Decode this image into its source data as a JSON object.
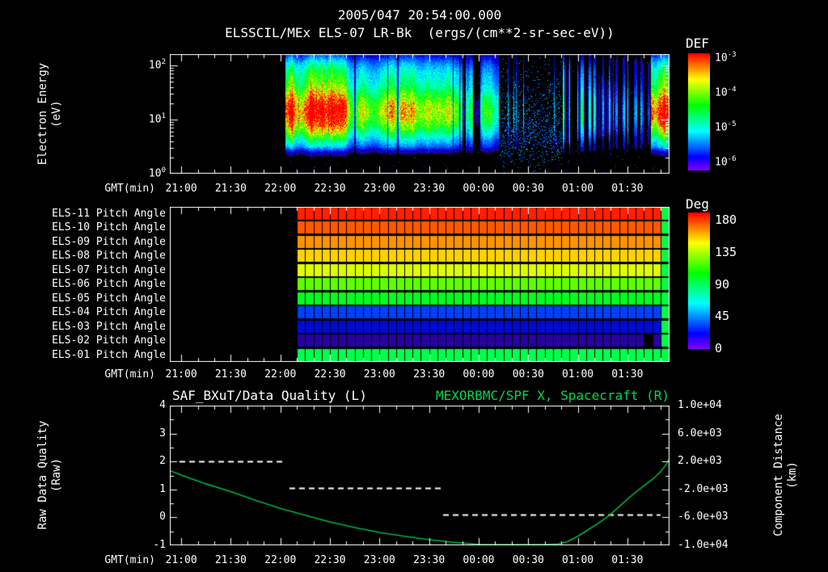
{
  "page": {
    "background": "#000000",
    "foreground": "#ffffff",
    "accent_green": "#00d84e"
  },
  "title": {
    "line1": "2005/047 20:54:00.000",
    "line2": "ELSSCIL/MEx ELS-07 LR-Bk  (ergs/(cm**2-sr-sec-eV))"
  },
  "time_axis": {
    "label": "GMT(min)",
    "ticks": [
      "21:00",
      "21:30",
      "22:00",
      "22:30",
      "23:00",
      "23:30",
      "00:00",
      "00:30",
      "01:00",
      "01:30"
    ],
    "tick_interval_min": 30,
    "t_start_min": -6.9,
    "t_end_min": 295.5
  },
  "labels": {
    "p1_ylabel_line1": "Electron Energy",
    "p1_ylabel_line2": "(eV)",
    "p3_left_ylabel_line1": "Raw Data Quality",
    "p3_left_ylabel_line2": "(Raw)",
    "p3_right_ylabel_line1": "Component Distance",
    "p3_right_ylabel_line2": "(km)"
  },
  "chart_data": [
    {
      "id": "electron_energy_spectrogram",
      "type": "heatmap",
      "title": "ELSSCIL/MEx ELS-07 LR-Bk",
      "units": "ergs/(cm**2-sr-sec-eV)",
      "xlabel": "GMT(min)",
      "ylabel": "Electron Energy (eV)",
      "yscale": "log",
      "ylim_ev": [
        1,
        160
      ],
      "ytick_labels": [
        "10^0",
        "10^1",
        "10^2"
      ],
      "colorbar": {
        "title": "DEF",
        "tick_labels": [
          "10^-3",
          "10^-4",
          "10^-5",
          "10^-6"
        ],
        "zmin": 1e-06,
        "zmax": 0.001
      },
      "band_model": {
        "peak_ev": 14,
        "log10_sigma": 0.4,
        "shoulder_ev": 85,
        "low_cutoff_ev": 3.2
      },
      "segments": [
        {
          "t0": 63,
          "t1": 100,
          "style": "hot",
          "intensity": 0.95
        },
        {
          "t0": 100,
          "t1": 168,
          "style": "steady",
          "intensity": 0.78
        },
        {
          "t0": 168,
          "t1": 192,
          "style": "patchy",
          "intensity": 0.62
        },
        {
          "t0": 192,
          "t1": 230,
          "style": "sparse",
          "intensity": 0.22
        },
        {
          "t0": 230,
          "t1": 284,
          "style": "stripes",
          "intensity": 0.55
        },
        {
          "t0": 284,
          "t1": 295.5,
          "style": "hot",
          "intensity": 0.9
        }
      ]
    },
    {
      "id": "pitch_angle_rows",
      "type": "heatmap",
      "colorbar": {
        "title": "Deg",
        "ticks": [
          180,
          135,
          90,
          45,
          0
        ],
        "zmin": 0,
        "zmax": 180
      },
      "data_start_min": 70,
      "cell_minutes": 5,
      "tail": {
        "from_min": 290,
        "deg": 90
      },
      "gap_cells": [
        {
          "row_index": 9,
          "t0": 280
        }
      ],
      "rows": [
        {
          "label": "ELS-11 Pitch Angle",
          "deg": 175
        },
        {
          "label": "ELS-10 Pitch Angle",
          "deg": 166
        },
        {
          "label": "ELS-09 Pitch Angle",
          "deg": 157
        },
        {
          "label": "ELS-08 Pitch Angle",
          "deg": 147
        },
        {
          "label": "ELS-07 Pitch Angle",
          "deg": 135
        },
        {
          "label": "ELS-06 Pitch Angle",
          "deg": 115
        },
        {
          "label": "ELS-05 Pitch Angle",
          "deg": 95
        },
        {
          "label": "ELS-04 Pitch Angle",
          "deg": 30
        },
        {
          "label": "ELS-03 Pitch Angle",
          "deg": 22
        },
        {
          "label": "ELS-02 Pitch Angle",
          "deg": 10
        },
        {
          "label": "ELS-01 Pitch Angle",
          "deg": 88
        }
      ]
    },
    {
      "id": "data_quality_and_spacecraft_distance",
      "type": "line",
      "title_left": "SAF_BXuT/Data Quality (L)",
      "title_right": "MEXORBMC/SPF X, Spacecraft (R)",
      "ylabel_left": "Raw Data Quality (Raw)",
      "ylabel_right": "Component Distance (km)",
      "ylim_left": [
        -1,
        4
      ],
      "yticks_left": [
        4,
        3,
        2,
        1,
        0,
        -1
      ],
      "ylim_right": [
        -10000,
        10000
      ],
      "ytick_labels_right": [
        "1.0e+04",
        "6.0e+03",
        "2.0e+03",
        "-2.0e+03",
        "-6.0e+03",
        "-1.0e+04"
      ],
      "series": [
        {
          "name": "SAF_BXuT/Data Quality (L)",
          "axis": "left",
          "style": "dashed",
          "color": "#ffffff",
          "segments": [
            {
              "t0": -1,
              "t1": 63,
              "value": 2.0
            },
            {
              "t0": 65.5,
              "t1": 157,
              "value": 1.05
            },
            {
              "t0": 158.5,
              "t1": 290,
              "value": 0.1
            }
          ]
        },
        {
          "name": "MEXORBMC/SPF X, Spacecraft (R)",
          "axis": "right",
          "style": "solid",
          "color": "#00b43c",
          "points": [
            [
              -6.9,
              700
            ],
            [
              0,
              50
            ],
            [
              15,
              -1200
            ],
            [
              30,
              -2300
            ],
            [
              45,
              -3550
            ],
            [
              60,
              -4700
            ],
            [
              75,
              -5700
            ],
            [
              90,
              -6650
            ],
            [
              105,
              -7450
            ],
            [
              120,
              -8150
            ],
            [
              135,
              -8700
            ],
            [
              150,
              -9200
            ],
            [
              165,
              -9570
            ],
            [
              180,
              -9850
            ],
            [
              192,
              -9970
            ],
            [
              200,
              -10000
            ],
            [
              220,
              -10000
            ],
            [
              228,
              -9800
            ],
            [
              234,
              -9450
            ],
            [
              240,
              -8700
            ],
            [
              246,
              -7800
            ],
            [
              252,
              -6900
            ],
            [
              258,
              -5900
            ],
            [
              264,
              -4700
            ],
            [
              270,
              -3400
            ],
            [
              276,
              -2200
            ],
            [
              282,
              -1100
            ],
            [
              286,
              -400
            ],
            [
              290,
              500
            ],
            [
              293,
              1400
            ],
            [
              295.5,
              2400
            ]
          ]
        }
      ]
    }
  ]
}
